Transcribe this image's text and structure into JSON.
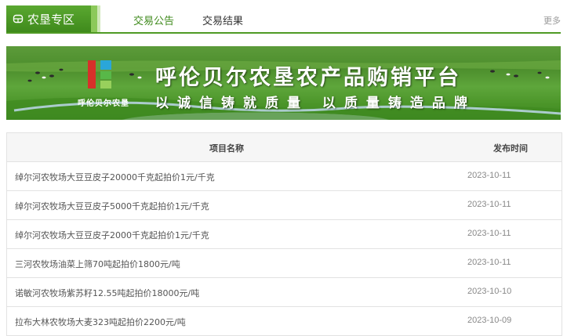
{
  "header": {
    "zone_title": "农垦专区",
    "tabs": [
      {
        "label": "交易公告",
        "active": true
      },
      {
        "label": "交易结果",
        "active": false
      }
    ],
    "more": "更多"
  },
  "banner": {
    "logo_text": "呼伦贝尔农垦",
    "title": "呼伦贝尔农垦农产品购销平台",
    "slogan": "以诚信铸就质量 以质量铸造品牌"
  },
  "table": {
    "columns": [
      "项目名称",
      "发布时间"
    ],
    "rows": [
      {
        "name": "绰尔河农牧场大豆豆皮子20000千克起拍价1元/千克",
        "date": "2023-10-11"
      },
      {
        "name": "绰尔河农牧场大豆豆皮子5000千克起拍价1元/千克",
        "date": "2023-10-11"
      },
      {
        "name": "绰尔河农牧场大豆豆皮子2000千克起拍价1元/千克",
        "date": "2023-10-11"
      },
      {
        "name": "三河农牧场油菜上筛70吨起拍价1800元/吨",
        "date": "2023-10-11"
      },
      {
        "name": "诺敏河农牧场紫苏籽12.55吨起拍价18000元/吨",
        "date": "2023-10-10"
      },
      {
        "name": "拉布大林农牧场大麦323吨起拍价2200元/吨",
        "date": "2023-10-09"
      }
    ]
  },
  "colors": {
    "accent": "#4f9a24",
    "banner_red": "#d7302a",
    "banner_cyan": "#2aa6d9"
  }
}
